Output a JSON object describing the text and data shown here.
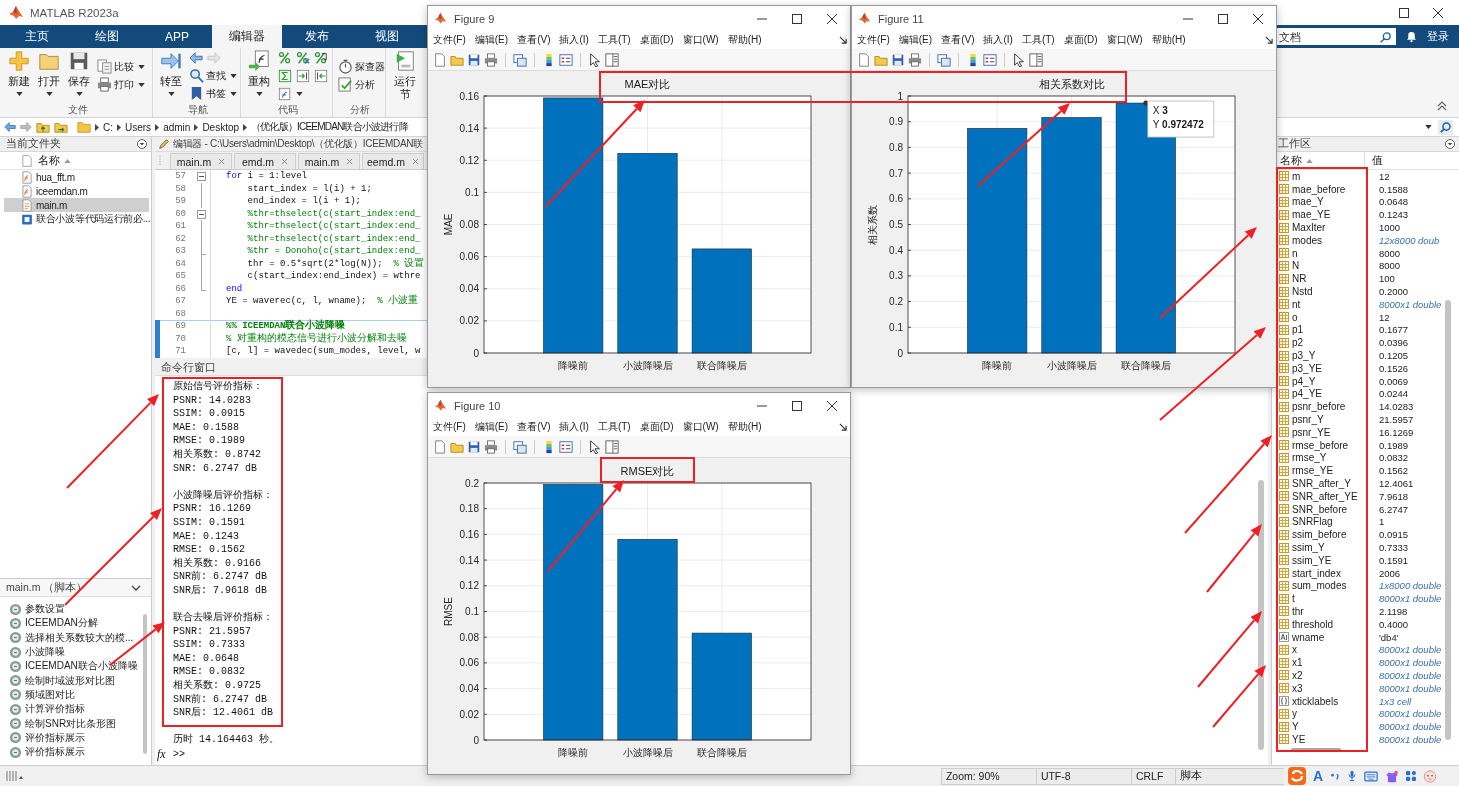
{
  "window": {
    "title": "MATLAB R2023a"
  },
  "ribbon": {
    "tabs": [
      {
        "label": "主页",
        "selected": false
      },
      {
        "label": "绘图",
        "selected": false
      },
      {
        "label": "APP",
        "selected": false
      },
      {
        "label": "编辑器",
        "selected": true
      },
      {
        "label": "发布",
        "selected": false
      },
      {
        "label": "视图",
        "selected": false
      }
    ],
    "search": {
      "placeholder": "文档"
    },
    "sign_in": "登录",
    "groups": [
      {
        "label": "文件",
        "columns": [
          [
            {
              "kind": "large",
              "label": "新建",
              "dropdown": true
            }
          ],
          [
            {
              "kind": "large",
              "label": "打开",
              "dropdown": true
            }
          ],
          [
            {
              "kind": "large",
              "label": "保存",
              "dropdown": true
            }
          ],
          [
            {
              "kind": "small",
              "label": "比较",
              "dropdown": true
            },
            {
              "kind": "small",
              "label": "打印",
              "dropdown": true
            }
          ]
        ]
      },
      {
        "label": "导航",
        "columns": [
          [
            {
              "kind": "large",
              "label": "转至",
              "dropdown": true
            }
          ],
          [
            {
              "kind": "history"
            },
            {
              "kind": "small",
              "label": "查找",
              "dropdown": true
            },
            {
              "kind": "small",
              "label": "书签",
              "dropdown": true
            }
          ]
        ]
      },
      {
        "label": "代码",
        "columns": [
          [
            {
              "kind": "large",
              "label": "重构",
              "dropdown": true
            }
          ],
          [
            {
              "kind": "tools"
            }
          ]
        ]
      },
      {
        "label": "分析",
        "columns": [
          [
            {
              "kind": "small",
              "label": "探查器",
              "dropdown": false
            },
            {
              "kind": "small",
              "label": "分析",
              "dropdown": false
            }
          ]
        ]
      },
      {
        "columns": [
          [
            {
              "kind": "large",
              "label": "运行节",
              "dropdown": false
            }
          ]
        ]
      }
    ]
  },
  "address_bar": {
    "path": [
      "C:",
      "Users",
      "admin",
      "Desktop",
      "（优化版）ICEEMDAN联合小波进行降"
    ]
  },
  "current_folder": {
    "title": "当前文件夹",
    "column": "名称",
    "files": [
      {
        "name": "hua_fft.m",
        "kind": "function",
        "selected": false
      },
      {
        "name": "iceemdan.m",
        "kind": "function",
        "selected": false
      },
      {
        "name": "main.m",
        "kind": "script",
        "selected": true
      },
      {
        "name": "联合小波等代码运行前必...",
        "kind": "document",
        "selected": false
      }
    ]
  },
  "outline": {
    "title": "main.m （脚本）",
    "sections": [
      "参数设置",
      "ICEEMDAN分解",
      "选择相关系数较大的模...",
      "小波降噪",
      "ICEEMDAN联合小波降噪",
      "绘制时域波形对比图",
      "频域图对比",
      "计算评价指标",
      "绘制SNR对比条形图",
      "评价指标展示",
      "评价指标展示"
    ]
  },
  "editor": {
    "title": "编辑器 - C:\\Users\\admin\\Desktop\\（优化版）ICEEMDAN联",
    "tabs": [
      "main.m",
      "emd.m",
      "main.m",
      "eemd.m"
    ],
    "lines": [
      {
        "number": "57",
        "fold_start": true,
        "fold_end": false,
        "active": false,
        "tokens": [
          {
            "kind": "keyword",
            "text": "for"
          },
          {
            "kind": "plain",
            "text": " i = 1:level"
          }
        ]
      },
      {
        "number": "58",
        "fold_start": false,
        "fold_end": false,
        "active": false,
        "tokens": [
          {
            "kind": "plain",
            "text": "    start_index = l(i) + 1;"
          }
        ]
      },
      {
        "number": "59",
        "fold_start": false,
        "fold_end": false,
        "active": false,
        "tokens": [
          {
            "kind": "plain",
            "text": "    end_index = l(i + 1);"
          }
        ]
      },
      {
        "number": "60",
        "fold_start": true,
        "fold_end": false,
        "active": false,
        "tokens": [
          {
            "kind": "comment",
            "text": "    %thr=thselect(c(start_index:end_"
          }
        ]
      },
      {
        "number": "61",
        "fold_start": false,
        "fold_end": false,
        "active": false,
        "tokens": [
          {
            "kind": "comment",
            "text": "    %thr=thselect(c(start_index:end_"
          }
        ]
      },
      {
        "number": "62",
        "fold_start": false,
        "fold_end": false,
        "active": false,
        "tokens": [
          {
            "kind": "comment",
            "text": "    %thr=thselect(c(start_index:end_"
          }
        ]
      },
      {
        "number": "63",
        "fold_start": false,
        "fold_end": true,
        "active": false,
        "tokens": [
          {
            "kind": "comment",
            "text": "    %thr = Donoho(c(start_index:end_"
          }
        ]
      },
      {
        "number": "64",
        "fold_start": false,
        "fold_end": false,
        "active": false,
        "tokens": [
          {
            "kind": "plain",
            "text": "    thr = 0.5*sqrt(2*log(N));  "
          },
          {
            "kind": "comment",
            "text": "% 设置"
          }
        ]
      },
      {
        "number": "65",
        "fold_start": false,
        "fold_end": false,
        "active": false,
        "tokens": [
          {
            "kind": "plain",
            "text": "    c(start_index:end_index) = wthre"
          }
        ]
      },
      {
        "number": "66",
        "fold_start": false,
        "fold_end": true,
        "active": false,
        "tokens": [
          {
            "kind": "keyword",
            "text": "end"
          }
        ]
      },
      {
        "number": "67",
        "fold_start": false,
        "fold_end": false,
        "active": false,
        "tokens": [
          {
            "kind": "plain",
            "text": "YE = waverec(c, l, wname);  "
          },
          {
            "kind": "comment",
            "text": "% 小波重"
          }
        ]
      },
      {
        "number": "68",
        "fold_start": false,
        "fold_end": false,
        "active": false
      },
      {
        "number": "69",
        "fold_start": false,
        "fold_end": false,
        "active": true,
        "tokens": [
          {
            "kind": "section",
            "text": "%% ICEEMDAN联合小波降噪"
          }
        ]
      },
      {
        "number": "70",
        "fold_start": false,
        "fold_end": false,
        "active": true,
        "tokens": [
          {
            "kind": "comment",
            "text": "% 对重构的模态信号进行小波分解和去噪"
          }
        ]
      },
      {
        "number": "71",
        "fold_start": false,
        "fold_end": false,
        "active": true,
        "tokens": [
          {
            "kind": "plain",
            "text": "[c, l] = wavedec(sum_modes, level, w"
          }
        ]
      }
    ]
  },
  "command_window": {
    "title": "命令行窗口",
    "blocks": [
      [
        "原始信号评价指标：",
        "PSNR: 14.0283",
        "SSIM: 0.0915",
        "MAE: 0.1588",
        "RMSE: 0.1989",
        "相关系数: 0.8742",
        "SNR: 6.2747 dB"
      ],
      [
        "小波降噪后评价指标：",
        "PSNR: 16.1269",
        "SSIM: 0.1591",
        "MAE: 0.1243",
        "RMSE: 0.1562",
        "相关系数: 0.9166",
        "SNR前: 6.2747 dB",
        "SNR后: 7.9618 dB"
      ],
      [
        "联合去噪后评价指标：",
        "PSNR: 21.5957",
        "SSIM: 0.7333",
        "MAE: 0.0648",
        "RMSE: 0.0832",
        "相关系数: 0.9725",
        "SNR前: 6.2747 dB",
        "SNR后: 12.4061 dB"
      ],
      [
        "历时 14.164463 秒。"
      ]
    ],
    "prompt_icon": "fx",
    "prompt": ">>"
  },
  "workspace": {
    "title": "工作区",
    "columns": [
      "名称",
      "值"
    ],
    "variables": [
      {
        "name": "m",
        "value": "12",
        "kind": "numeric",
        "summary": false
      },
      {
        "name": "mae_before",
        "value": "0.1588",
        "kind": "numeric",
        "summary": false
      },
      {
        "name": "mae_Y",
        "value": "0.0648",
        "kind": "numeric",
        "summary": false
      },
      {
        "name": "mae_YE",
        "value": "0.1243",
        "kind": "numeric",
        "summary": false
      },
      {
        "name": "MaxIter",
        "value": "1000",
        "kind": "numeric",
        "summary": false
      },
      {
        "name": "modes",
        "value": "12x8000 doub",
        "kind": "numeric",
        "summary": true
      },
      {
        "name": "n",
        "value": "8000",
        "kind": "numeric",
        "summary": false
      },
      {
        "name": "N",
        "value": "8000",
        "kind": "numeric",
        "summary": false
      },
      {
        "name": "NR",
        "value": "100",
        "kind": "numeric",
        "summary": false
      },
      {
        "name": "Nstd",
        "value": "0.2000",
        "kind": "numeric",
        "summary": false
      },
      {
        "name": "nt",
        "value": "8000x1 double",
        "kind": "numeric",
        "summary": true
      },
      {
        "name": "o",
        "value": "12",
        "kind": "numeric",
        "summary": false
      },
      {
        "name": "p1",
        "value": "0.1677",
        "kind": "numeric",
        "summary": false
      },
      {
        "name": "p2",
        "value": "0.0396",
        "kind": "numeric",
        "summary": false
      },
      {
        "name": "p3_Y",
        "value": "0.1205",
        "kind": "numeric",
        "summary": false
      },
      {
        "name": "p3_YE",
        "value": "0.1526",
        "kind": "numeric",
        "summary": false
      },
      {
        "name": "p4_Y",
        "value": "0.0069",
        "kind": "numeric",
        "summary": false
      },
      {
        "name": "p4_YE",
        "value": "0.0244",
        "kind": "numeric",
        "summary": false
      },
      {
        "name": "psnr_before",
        "value": "14.0283",
        "kind": "numeric",
        "summary": false
      },
      {
        "name": "psnr_Y",
        "value": "21.5957",
        "kind": "numeric",
        "summary": false
      },
      {
        "name": "psnr_YE",
        "value": "16.1269",
        "kind": "numeric",
        "summary": false
      },
      {
        "name": "rmse_before",
        "value": "0.1989",
        "kind": "numeric",
        "summary": false
      },
      {
        "name": "rmse_Y",
        "value": "0.0832",
        "kind": "numeric",
        "summary": false
      },
      {
        "name": "rmse_YE",
        "value": "0.1562",
        "kind": "numeric",
        "summary": false
      },
      {
        "name": "SNR_after_Y",
        "value": "12.4061",
        "kind": "numeric",
        "summary": false
      },
      {
        "name": "SNR_after_YE",
        "value": "7.9618",
        "kind": "numeric",
        "summary": false
      },
      {
        "name": "SNR_before",
        "value": "6.2747",
        "kind": "numeric",
        "summary": false
      },
      {
        "name": "SNRFlag",
        "value": "1",
        "kind": "numeric",
        "summary": false
      },
      {
        "name": "ssim_before",
        "value": "0.0915",
        "kind": "numeric",
        "summary": false
      },
      {
        "name": "ssim_Y",
        "value": "0.7333",
        "kind": "numeric",
        "summary": false
      },
      {
        "name": "ssim_YE",
        "value": "0.1591",
        "kind": "numeric",
        "summary": false
      },
      {
        "name": "start_index",
        "value": "2006",
        "kind": "numeric",
        "summary": false
      },
      {
        "name": "sum_modes",
        "value": "1x8000 double",
        "kind": "numeric",
        "summary": true
      },
      {
        "name": "t",
        "value": "8000x1 double",
        "kind": "numeric",
        "summary": true
      },
      {
        "name": "thr",
        "value": "2.1198",
        "kind": "numeric",
        "summary": false
      },
      {
        "name": "threshold",
        "value": "0.4000",
        "kind": "numeric",
        "summary": false
      },
      {
        "name": "wname",
        "value": "'db4'",
        "kind": "char",
        "summary": false
      },
      {
        "name": "x",
        "value": "8000x1 double",
        "kind": "numeric",
        "summary": true
      },
      {
        "name": "x1",
        "value": "8000x1 double",
        "kind": "numeric",
        "summary": true
      },
      {
        "name": "x2",
        "value": "8000x1 double",
        "kind": "numeric",
        "summary": true
      },
      {
        "name": "x3",
        "value": "8000x1 double",
        "kind": "numeric",
        "summary": true
      },
      {
        "name": "xticklabels",
        "value": "1x3 cell",
        "kind": "cell",
        "summary": true
      },
      {
        "name": "y",
        "value": "8000x1 double",
        "kind": "numeric",
        "summary": true
      },
      {
        "name": "Y",
        "value": "8000x1 double",
        "kind": "numeric",
        "summary": true
      },
      {
        "name": "YE",
        "value": "8000x1 double",
        "kind": "numeric",
        "summary": true
      }
    ]
  },
  "status_bar": {
    "fields": [
      "Zoom: 90%",
      "UTF-8",
      "CRLF",
      "脚本"
    ],
    "ime_mode": "A"
  },
  "figures": [
    {
      "title": "Figure 9",
      "menu": [
        "文件(F)",
        "编辑(E)",
        "查看(V)",
        "插入(I)",
        "工具(T)",
        "桌面(D)",
        "窗口(W)",
        "帮助(H)"
      ],
      "chart_data": {
        "type": "bar",
        "title": "MAE对比",
        "ylabel": "MAE",
        "categories": [
          "降噪前",
          "小波降噪后",
          "联合降噪后"
        ],
        "values": [
          0.1588,
          0.1243,
          0.0648
        ],
        "ylim": [
          0,
          0.16
        ],
        "yticks": [
          0,
          0.02,
          0.04,
          0.06,
          0.08,
          0.1,
          0.12,
          0.14,
          0.16
        ],
        "grid": true
      }
    },
    {
      "title": "Figure 11",
      "menu": [
        "文件(F)",
        "编辑(E)",
        "查看(V)",
        "插入(I)",
        "工具(T)",
        "桌面(D)",
        "窗口(W)",
        "帮助(H)"
      ],
      "chart_data": {
        "type": "bar",
        "title": "相关系数对比",
        "ylabel": "相关系数",
        "categories": [
          "降噪前",
          "小波降噪后",
          "联合降噪后"
        ],
        "values": [
          0.8742,
          0.9166,
          0.9725
        ],
        "ylim": [
          0,
          1
        ],
        "yticks": [
          0,
          0.1,
          0.2,
          0.3,
          0.4,
          0.5,
          0.6,
          0.7,
          0.8,
          0.9,
          1
        ],
        "grid": true
      },
      "datatip": [
        {
          "label": "X",
          "value": "3"
        },
        {
          "label": "Y",
          "value": "0.972472"
        }
      ]
    },
    {
      "title": "Figure 10",
      "menu": [
        "文件(F)",
        "编辑(E)",
        "查看(V)",
        "插入(I)",
        "工具(T)",
        "桌面(D)",
        "窗口(W)",
        "帮助(H)"
      ],
      "chart_data": {
        "type": "bar",
        "title": "RMSE对比",
        "ylabel": "RMSE",
        "categories": [
          "降噪前",
          "小波降噪后",
          "联合降噪后"
        ],
        "values": [
          0.1989,
          0.1562,
          0.0832
        ],
        "ylim": [
          0,
          0.2
        ],
        "yticks": [
          0,
          0.02,
          0.04,
          0.06,
          0.08,
          0.1,
          0.12,
          0.14,
          0.16,
          0.18,
          0.2
        ],
        "grid": true
      }
    }
  ]
}
